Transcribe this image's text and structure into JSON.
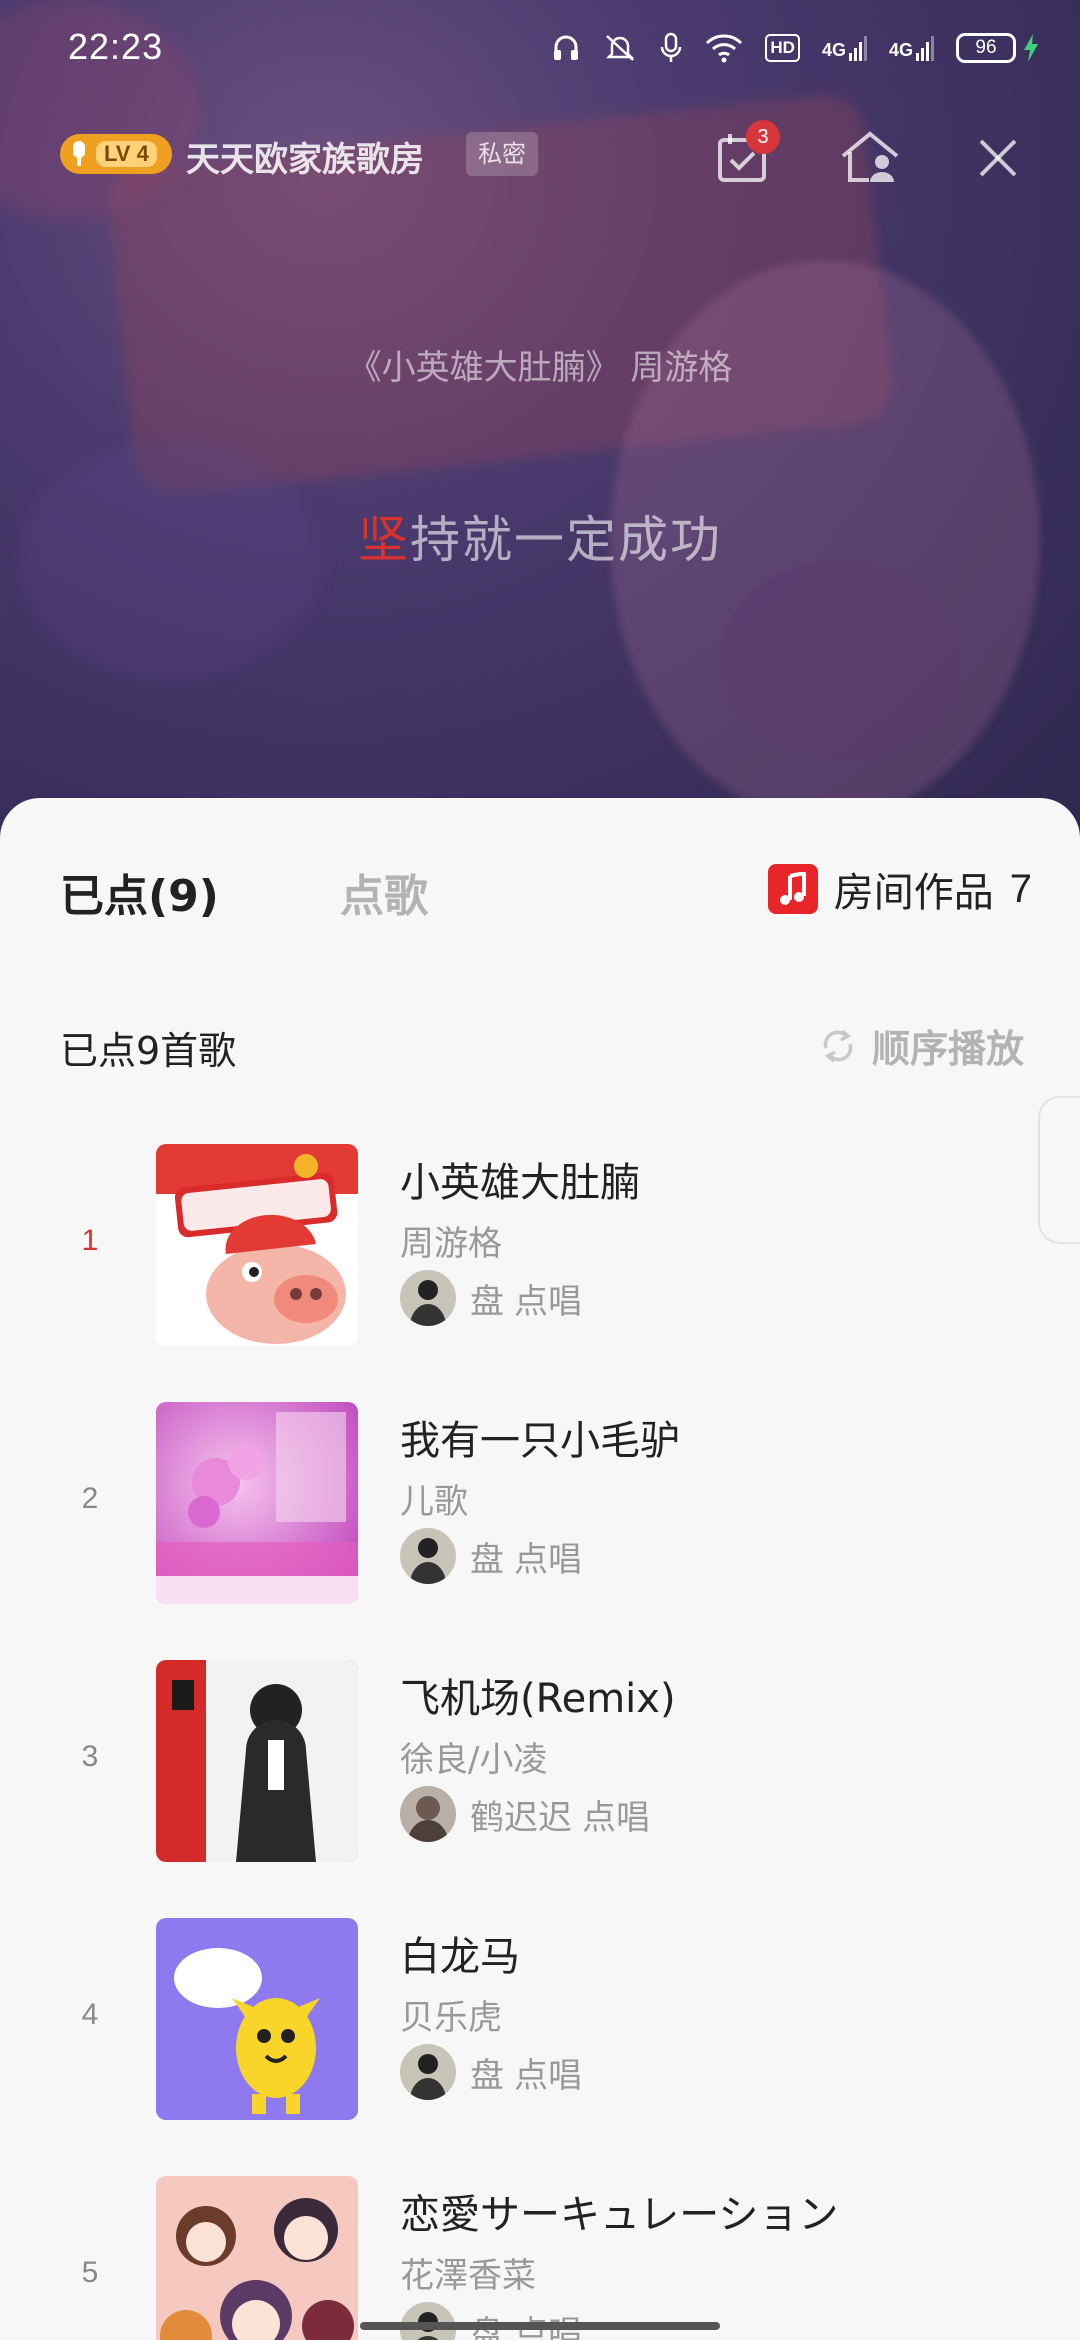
{
  "status_bar": {
    "time": "22:23",
    "network_left": "4G",
    "network_right": "4G",
    "hd_label": "HD",
    "battery": "96"
  },
  "room": {
    "level_badge": "LV 4",
    "name": "天天欧家族歌房",
    "privacy_tag": "私密",
    "checkin_badge_count": "3"
  },
  "now_playing": {
    "title_line": "《小英雄大肚腩》 周游格",
    "lyric_highlight": "坚",
    "lyric_rest": "持就一定成功"
  },
  "sheet": {
    "tabs": [
      {
        "label": "已点(9)",
        "selected": true
      },
      {
        "label": "点歌",
        "selected": false
      }
    ],
    "room_works_label": "房间作品",
    "room_works_count": "7",
    "list_header": "已点9首歌",
    "play_mode_label": "顺序播放",
    "accent_color": "#d8322f"
  },
  "songs": [
    {
      "index": "1",
      "title": "小英雄大肚腩",
      "artist": "周游格",
      "requester": "盘",
      "action": "点唱",
      "playing": true
    },
    {
      "index": "2",
      "title": "我有一只小毛驴",
      "artist": "儿歌",
      "requester": "盘",
      "action": "点唱",
      "playing": false
    },
    {
      "index": "3",
      "title": "飞机场(Remix)",
      "artist": "徐良/小凌",
      "requester": "鹤迟迟",
      "action": "点唱",
      "playing": false
    },
    {
      "index": "4",
      "title": "白龙马",
      "artist": "贝乐虎",
      "requester": "盘",
      "action": "点唱",
      "playing": false
    },
    {
      "index": "5",
      "title": "恋愛サーキュレーション",
      "artist": "花澤香菜",
      "requester": "盘",
      "action": "点唱",
      "playing": false
    }
  ],
  "icons": {
    "status": [
      "headphones-icon",
      "mute-icon",
      "mic-icon",
      "wifi-icon",
      "hd-icon",
      "signal-icon",
      "battery-icon",
      "charging-icon"
    ],
    "header": [
      "checkin-icon",
      "home-user-icon",
      "close-icon"
    ],
    "sheet": [
      "music-note-icon",
      "repeat-icon"
    ]
  }
}
